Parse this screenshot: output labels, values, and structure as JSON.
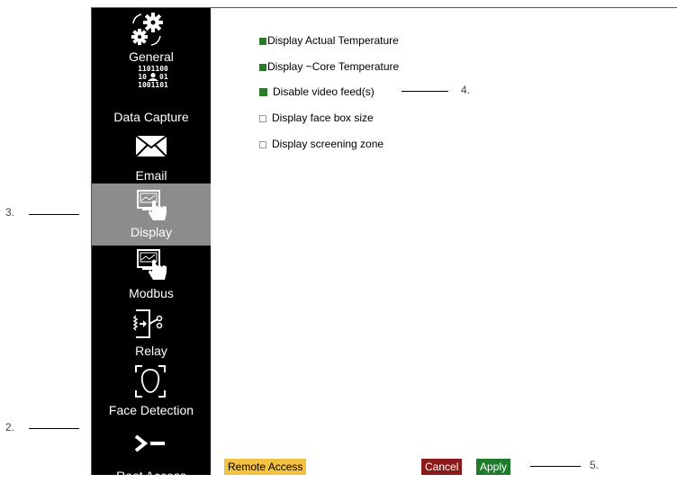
{
  "sidebar": {
    "items": [
      {
        "label": "General",
        "icon": "gears-icon"
      },
      {
        "label": "Data Capture",
        "icon": "binary-person-icon",
        "binary": [
          "1101100",
          "10",
          "01",
          "1001101"
        ]
      },
      {
        "label": "Email",
        "icon": "envelope-icon"
      },
      {
        "label": "Display",
        "icon": "touch-display-icon",
        "active": true
      },
      {
        "label": "Modbus",
        "icon": "touch-display-icon"
      },
      {
        "label": "Relay",
        "icon": "relay-icon"
      },
      {
        "label": "Face Detection",
        "icon": "face-detection-icon"
      },
      {
        "label": "Root Access",
        "icon": "terminal-prompt-icon"
      }
    ]
  },
  "options": [
    {
      "label": "Display Actual Temperature",
      "checked": true
    },
    {
      "label": "Display ~Core Temperature",
      "checked": true
    },
    {
      "label": "Disable video feed(s)",
      "checked": true
    },
    {
      "label": "Display face box size",
      "checked": false
    },
    {
      "label": "Display screening zone",
      "checked": false
    }
  ],
  "buttons": {
    "remote_access": "Remote Access",
    "cancel": "Cancel",
    "apply": "Apply"
  },
  "callouts": {
    "c2": "2.",
    "c3": "3.",
    "c4": "4.",
    "c5": "5."
  },
  "colors": {
    "sidebar_bg": "#000000",
    "active_bg": "#8c8c8c",
    "checked": "#2a7a2a",
    "remote": "#f4c242",
    "cancel": "#8b1a1a",
    "apply": "#1f7a2a"
  }
}
